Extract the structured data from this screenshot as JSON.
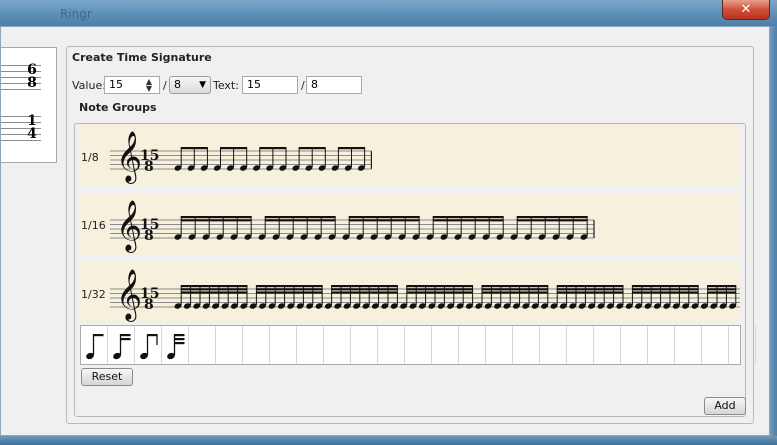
{
  "window": {
    "title": "Ringr",
    "close_label": "✕"
  },
  "signatures": [
    {
      "numerator": "6",
      "denominator": "8"
    },
    {
      "numerator": "1",
      "denominator": "4"
    }
  ],
  "create": {
    "title": "Create Time Signature",
    "value_label": "Value:",
    "value": "15",
    "slash": "/",
    "denominator_value": "8",
    "text_label": "Text:",
    "text_numerator": "15",
    "text_slash": "/",
    "text_denominator": "8"
  },
  "note_groups": {
    "title": "Note Groups",
    "rows": [
      {
        "label": "1/8",
        "numerator": "15",
        "denominator": "8",
        "notes": 15,
        "group_size": 3,
        "beams": 1
      },
      {
        "label": "1/16",
        "numerator": "15",
        "denominator": "8",
        "notes": 30,
        "group_size": 6,
        "beams": 2
      },
      {
        "label": "1/32",
        "numerator": "15",
        "denominator": "8",
        "notes": 60,
        "group_size": 8,
        "beams": 3
      }
    ],
    "palette_icons": [
      "eighth-note-icon",
      "sixteenth-note-icon",
      "beamed-eighth-icon",
      "beamed-sixteenth-icon"
    ],
    "reset_label": "Reset"
  },
  "add_label": "Add"
}
